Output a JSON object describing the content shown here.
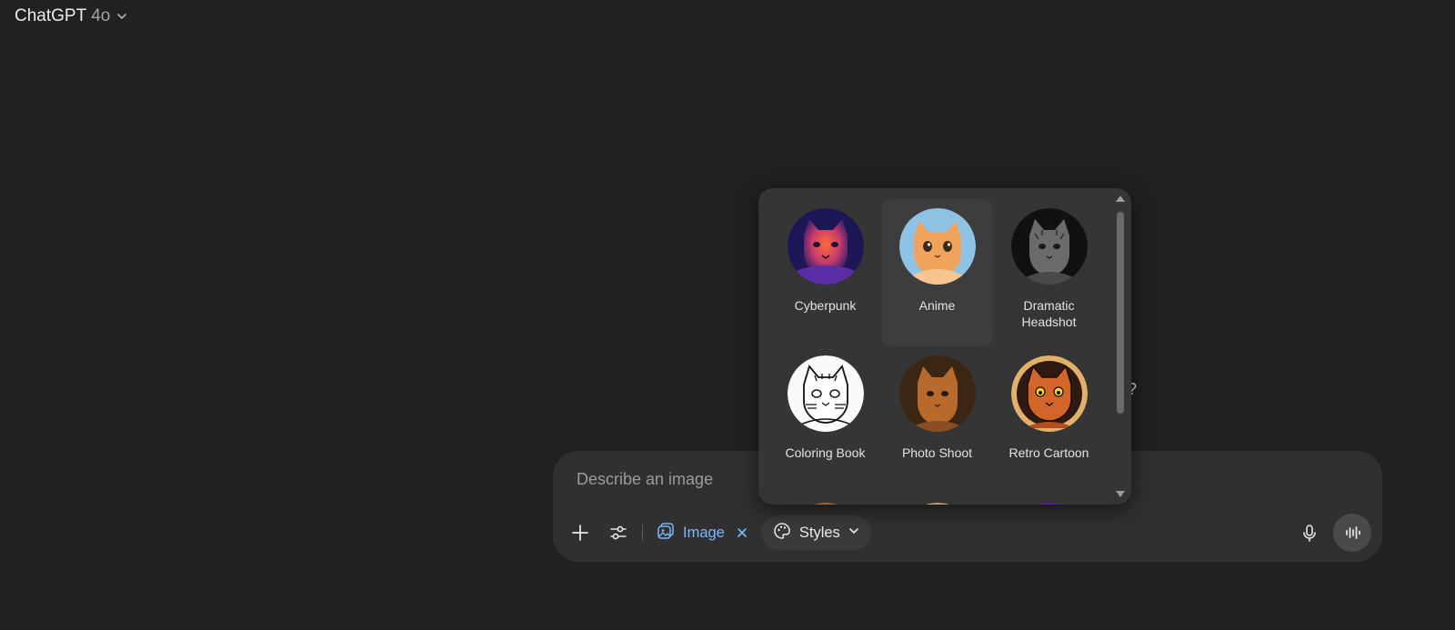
{
  "header": {
    "model_name": "ChatGPT",
    "model_version": "4o",
    "chevron_icon": "chevron-down-icon"
  },
  "composer": {
    "placeholder": "Describe an image",
    "value": "",
    "image_chip_label": "Image",
    "styles_label": "Styles",
    "icons": [
      "plus-icon",
      "sliders-icon",
      "image-icon",
      "close-icon",
      "palette-icon",
      "chevron-down-icon",
      "microphone-icon",
      "voice-waveform-icon"
    ]
  },
  "styles_menu": {
    "items": [
      {
        "label": "Cyberpunk",
        "icon": "cat-cyberpunk-thumbnail"
      },
      {
        "label": "Anime",
        "icon": "cat-anime-thumbnail",
        "highlighted": true
      },
      {
        "label": "Dramatic Headshot",
        "icon": "cat-dramatic-headshot-thumbnail"
      },
      {
        "label": "Coloring Book",
        "icon": "cat-coloring-book-thumbnail"
      },
      {
        "label": "Photo Shoot",
        "icon": "cat-photo-shoot-thumbnail"
      },
      {
        "label": "Retro Cartoon",
        "icon": "cat-retro-cartoon-thumbnail"
      }
    ]
  },
  "colors": {
    "background": "#212121",
    "composer": "#303030",
    "popover": "#353535",
    "accent": "#7ab7ff"
  }
}
